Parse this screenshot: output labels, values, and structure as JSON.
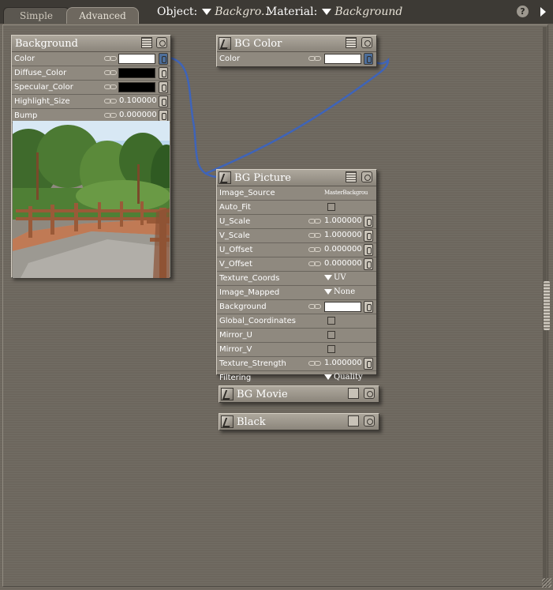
{
  "tabs": [
    {
      "label": "Simple"
    },
    {
      "label": "Advanced"
    }
  ],
  "header": {
    "object_label": "Object:",
    "object_value": "Backgro...",
    "material_label": "Material:",
    "material_value": "Background",
    "help_label": "?"
  },
  "nodes": {
    "background": {
      "title": "Background",
      "rows": [
        {
          "label": "Color"
        },
        {
          "label": "Diffuse_Color"
        },
        {
          "label": "Specular_Color"
        },
        {
          "label": "Highlight_Size",
          "value": "0.100000"
        },
        {
          "label": "Bump",
          "value": "0.000000"
        }
      ]
    },
    "bg_color": {
      "title": "BG Color",
      "rows": [
        {
          "label": "Color"
        }
      ]
    },
    "bg_picture": {
      "title": "BG Picture",
      "rows": [
        {
          "label": "Image_Source",
          "value": "MasterBackgrou"
        },
        {
          "label": "Auto_Fit"
        },
        {
          "label": "U_Scale",
          "value": "1.000000"
        },
        {
          "label": "V_Scale",
          "value": "1.000000"
        },
        {
          "label": "U_Offset",
          "value": "0.000000"
        },
        {
          "label": "V_Offset",
          "value": "0.000000"
        },
        {
          "label": "Texture_Coords",
          "value": "UV"
        },
        {
          "label": "Image_Mapped",
          "value": "None"
        },
        {
          "label": "Background"
        },
        {
          "label": "Global_Coordinates"
        },
        {
          "label": "Mirror_U"
        },
        {
          "label": "Mirror_V"
        },
        {
          "label": "Texture_Strength",
          "value": "1.000000"
        },
        {
          "label": "Filtering",
          "value": "Quality"
        }
      ]
    },
    "bg_movie": {
      "title": "BG Movie"
    },
    "black": {
      "title": "Black"
    }
  },
  "colors": {
    "white": "#ffffff",
    "black": "#000000",
    "connection": "#3f64b8",
    "panel": "#8f897f"
  },
  "icons": [
    "list-icon",
    "eye-icon",
    "node-type-icon",
    "link-icon",
    "plug-icon",
    "help-icon",
    "menu-arrow-icon"
  ]
}
